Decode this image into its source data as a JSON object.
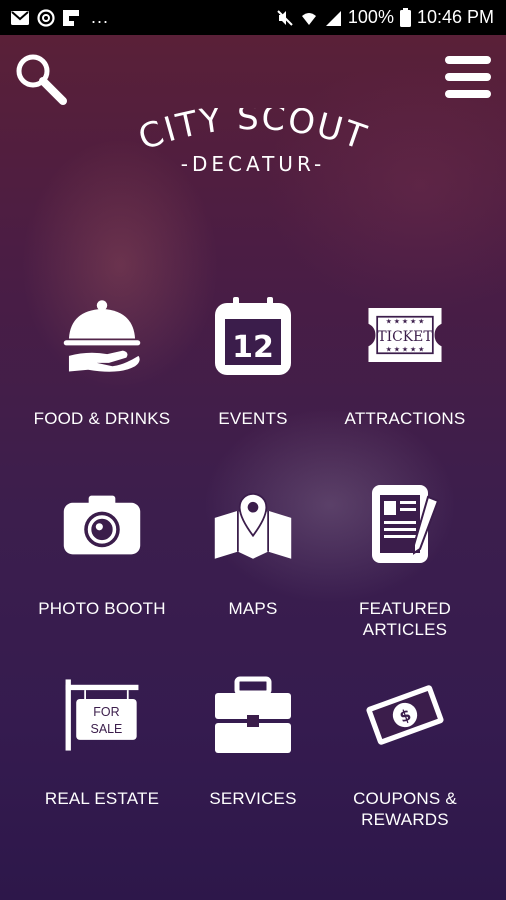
{
  "status_bar": {
    "left_icons": [
      "gmail-icon",
      "at-icon",
      "flipboard-icon"
    ],
    "overflow": "...",
    "battery": "100%",
    "time": "10:46 PM"
  },
  "header": {
    "search_icon": "search-icon",
    "menu_icon": "hamburger-menu-icon"
  },
  "logo": {
    "title": "CITY SCOUT",
    "subtitle": "-DECATUR-"
  },
  "tiles": [
    {
      "label": "FOOD & DRINKS",
      "icon": "food-cloche-icon"
    },
    {
      "label": "EVENTS",
      "icon": "calendar-icon",
      "icon_text": "12"
    },
    {
      "label": "ATTRACTIONS",
      "icon": "ticket-icon",
      "icon_text": "TICKET"
    },
    {
      "label": "PHOTO BOOTH",
      "icon": "camera-icon"
    },
    {
      "label": "MAPS",
      "icon": "map-pin-icon"
    },
    {
      "label": "FEATURED\nARTICLES",
      "icon": "article-pen-icon"
    },
    {
      "label": "REAL ESTATE",
      "icon": "for-sale-sign-icon",
      "icon_text": "FOR\nSALE"
    },
    {
      "label": "SERVICES",
      "icon": "toolbox-icon"
    },
    {
      "label": "COUPONS &\nREWARDS",
      "icon": "money-bill-icon",
      "icon_text": "$"
    }
  ]
}
